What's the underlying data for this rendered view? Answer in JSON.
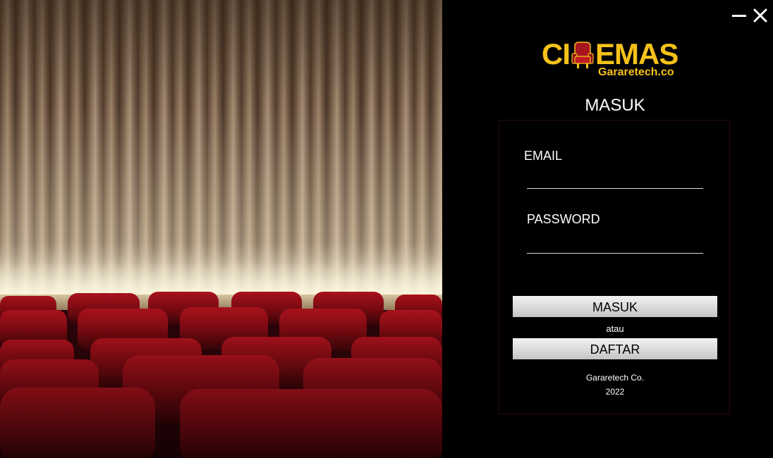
{
  "window": {
    "minimize_icon": "minimize-icon",
    "close_icon": "close-icon"
  },
  "logo": {
    "text_left": "CI",
    "text_right": "EMAS",
    "seat_icon": "cinema-seat-icon",
    "subtitle": "Gararetech.co",
    "color": "#f5c21a"
  },
  "login": {
    "title": "MASUK",
    "email_label": "EMAIL",
    "email_value": "",
    "password_label": "PASSWORD",
    "password_value": "",
    "submit_label": "MASUK",
    "or_text": "atau",
    "register_label": "DAFTAR"
  },
  "footer": {
    "company": "Gararetech Co.",
    "year": "2022"
  },
  "colors": {
    "background": "#000000",
    "accent": "#f5c21a",
    "seat_red": "#8e0f16",
    "button_gray": "#dcdcdc"
  }
}
